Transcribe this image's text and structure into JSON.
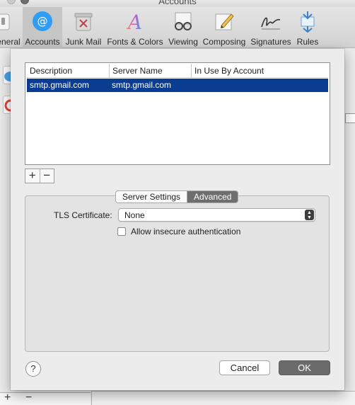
{
  "window": {
    "title": "Accounts"
  },
  "toolbar": {
    "items": [
      {
        "label": "eneral",
        "icon": "switch-icon"
      },
      {
        "label": "Accounts",
        "icon": "at-sign-icon"
      },
      {
        "label": "Junk Mail",
        "icon": "junk-mail-icon"
      },
      {
        "label": "Fonts & Colors",
        "icon": "fonts-colors-icon"
      },
      {
        "label": "Viewing",
        "icon": "glasses-icon"
      },
      {
        "label": "Composing",
        "icon": "pencil-icon"
      },
      {
        "label": "Signatures",
        "icon": "signature-icon"
      },
      {
        "label": "Rules",
        "icon": "rules-icon"
      }
    ],
    "selected": "Accounts"
  },
  "smtp_table": {
    "headers": [
      "Description",
      "Server Name",
      "In Use By Account"
    ],
    "rows": [
      {
        "description": "smtp.gmail.com",
        "server_name": "smtp.gmail.com",
        "in_use_by": ""
      }
    ]
  },
  "controls": {
    "add_label": "+",
    "remove_label": "−"
  },
  "tabs": {
    "items": [
      "Server Settings",
      "Advanced"
    ],
    "selected": "Advanced"
  },
  "advanced": {
    "tls_label": "TLS Certificate:",
    "tls_value": "None",
    "allow_insecure_label": "Allow insecure authentication",
    "allow_insecure_checked": false
  },
  "footer": {
    "help_label": "?",
    "cancel_label": "Cancel",
    "ok_label": "OK"
  },
  "colors": {
    "selection": "#0a3d91",
    "accent_blue": "#2f9cf6",
    "ok_button": "#6b6b6b"
  }
}
